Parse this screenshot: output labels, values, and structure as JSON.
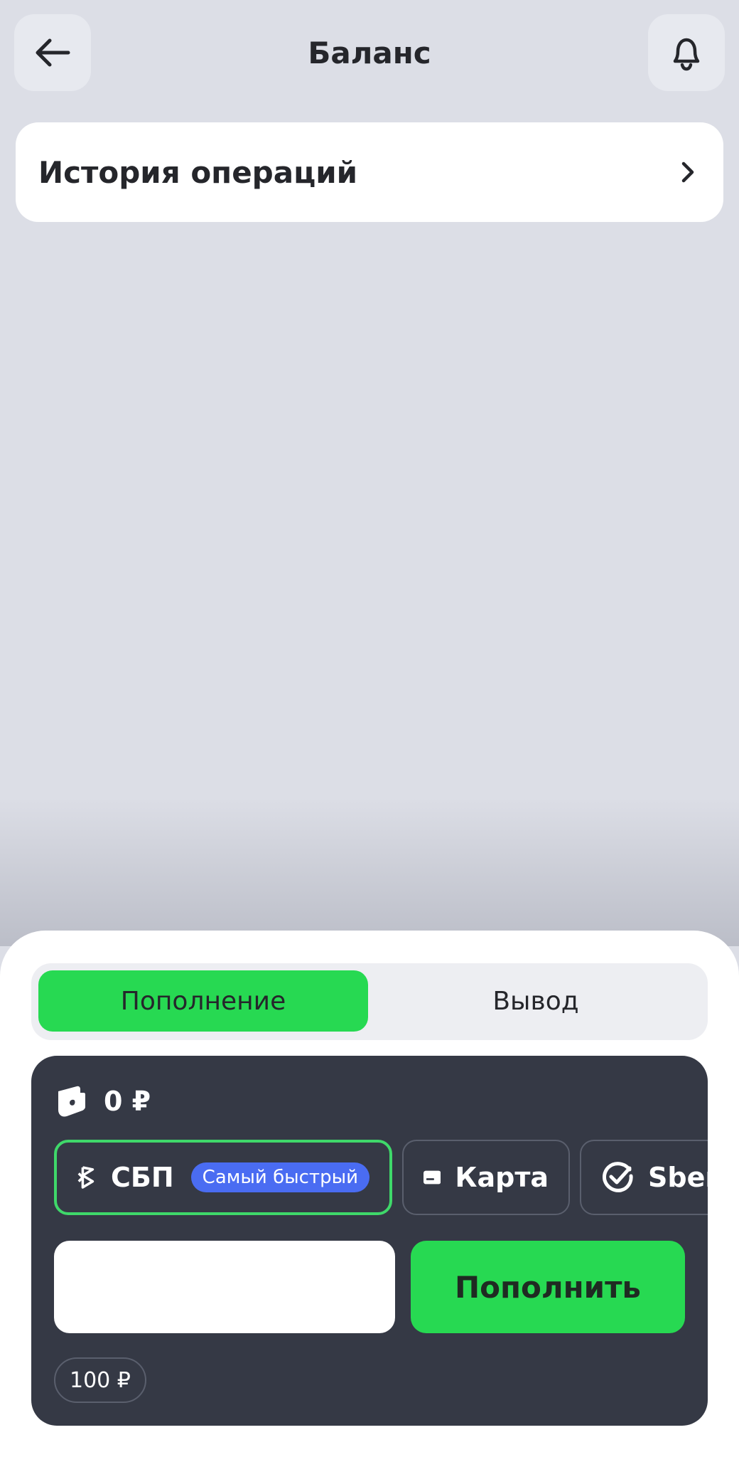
{
  "header": {
    "title": "Баланс",
    "back_icon": "arrow-left-icon",
    "bell_icon": "bell-icon"
  },
  "history": {
    "label": "История операций",
    "icon": "chevron-right-icon"
  },
  "sheet": {
    "tabs": [
      {
        "label": "Пополнение",
        "active": true
      },
      {
        "label": "Вывод",
        "active": false
      }
    ],
    "balance": {
      "icon": "wallet-icon",
      "value": "0 ₽"
    },
    "methods": [
      {
        "label": "СБП",
        "badge": "Самый быстрый",
        "icon": "sbp-icon",
        "selected": true
      },
      {
        "label": "Карта",
        "icon": "card-icon",
        "selected": false
      },
      {
        "label": "Sber",
        "icon": "check-circle-icon",
        "selected": false
      }
    ],
    "amount": {
      "value": "",
      "placeholder": ""
    },
    "submit_label": "Пополнить",
    "quick_amounts": [
      "100 ₽"
    ]
  },
  "colors": {
    "accent_green": "#27d952",
    "selected_border": "#3fd86a",
    "badge_blue": "#4a6cf2",
    "card_dark": "#353945",
    "background": "#dcdee6"
  }
}
